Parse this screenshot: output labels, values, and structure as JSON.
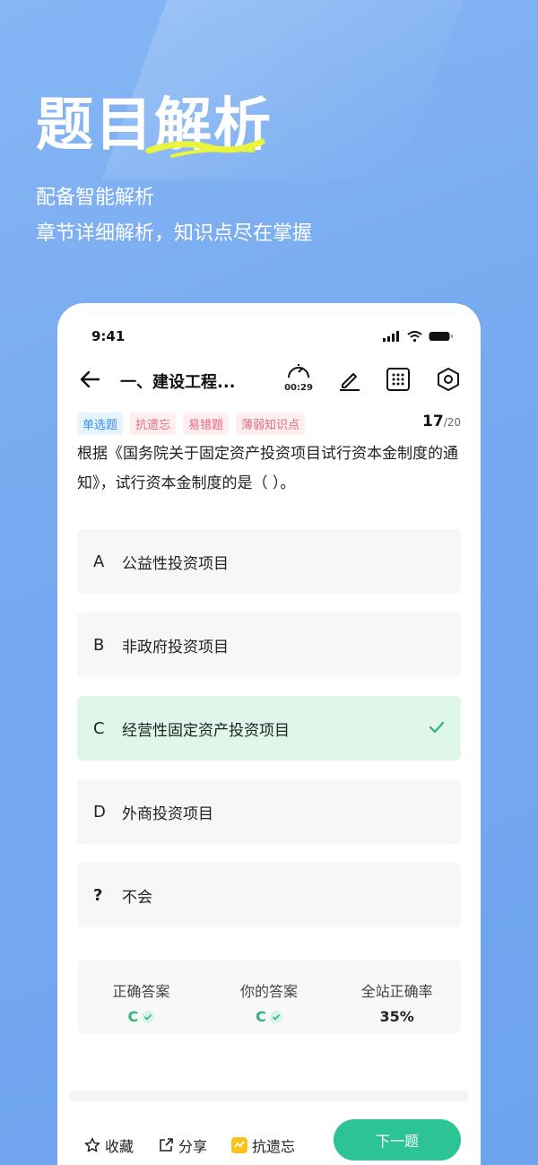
{
  "hero": {
    "title_plain": "题目",
    "title_accent": "解析",
    "subtitle1": "配备智能解析",
    "subtitle2": "章节详细解析，知识点尽在掌握"
  },
  "status": {
    "time": "9:41"
  },
  "nav": {
    "title": "一、建设工程...",
    "timer": "00:29"
  },
  "tags": [
    "单选题",
    "抗遗忘",
    "易错题",
    "薄弱知识点"
  ],
  "progress": {
    "current": "17",
    "total": "/20"
  },
  "question": "根据《国务院关于固定资产投资项目试行资本金制度的通知》，试行资本金制度的是（    ）。",
  "options": [
    {
      "letter": "A",
      "text": "公益性投资项目"
    },
    {
      "letter": "B",
      "text": "非政府投资项目"
    },
    {
      "letter": "C",
      "text": "经营性固定资产投资项目"
    },
    {
      "letter": "D",
      "text": "外商投资项目"
    },
    {
      "letter": "?",
      "text": "不会"
    }
  ],
  "stats": [
    {
      "label": "正确答案",
      "value": "C"
    },
    {
      "label": "你的答案",
      "value": "C"
    },
    {
      "label": "全站正确率",
      "value": "35%"
    }
  ],
  "bottom": {
    "favorite": "收藏",
    "share": "分享",
    "anti_forget": "抗遗忘",
    "next": "下一题"
  },
  "colors": {
    "background": "#76a9f0",
    "accent_green": "#2cc395",
    "correct_bg": "#dff7ea",
    "underline_yellow": "#e8f53a"
  }
}
